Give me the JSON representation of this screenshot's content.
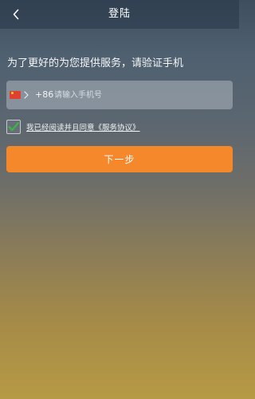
{
  "header": {
    "title": "登陆",
    "back_icon": "chevron-left-icon"
  },
  "main": {
    "prompt": "为了更好的为您提供服务，请验证手机",
    "phone": {
      "country_flag_icon": "china-flag-icon",
      "country_code": "+86",
      "placeholder": "请输入手机号",
      "value": ""
    },
    "agreement": {
      "checked": true,
      "text": "我已经阅读并且同意《服务协议》"
    },
    "next_label": "下一步"
  },
  "colors": {
    "accent": "#f5882a",
    "check": "#3fb24a"
  }
}
